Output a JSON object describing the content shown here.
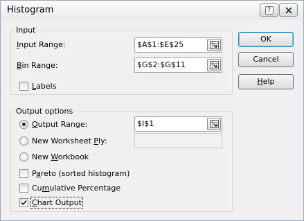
{
  "window": {
    "title": "Histogram"
  },
  "input_group": {
    "label": "Input",
    "input_range": {
      "label_pre": "",
      "label_ul": "I",
      "label_post": "nput Range:",
      "value": "$A$1:$E$25"
    },
    "bin_range": {
      "label_pre": "",
      "label_ul": "B",
      "label_post": "in Range:",
      "value": "$G$2:$G$11"
    },
    "labels": {
      "label_pre": "",
      "label_ul": "L",
      "label_post": "abels",
      "checked": false
    }
  },
  "output_group": {
    "label": "Output options",
    "output_range": {
      "label_pre": "",
      "label_ul": "O",
      "label_post": "utput Range:",
      "value": "$I$1",
      "selected": true
    },
    "new_worksheet": {
      "label_pre": "New Worksheet ",
      "label_ul": "P",
      "label_post": "ly:",
      "value": "",
      "selected": false
    },
    "new_workbook": {
      "label_pre": "New ",
      "label_ul": "W",
      "label_post": "orkbook",
      "selected": false
    },
    "pareto": {
      "label_pre": "P",
      "label_ul": "a",
      "label_post": "reto (sorted histogram)",
      "checked": false
    },
    "cumulative": {
      "label_pre": "Cu",
      "label_ul": "m",
      "label_post": "ulative Percentage",
      "checked": false
    },
    "chart_output": {
      "label_pre": "",
      "label_ul": "C",
      "label_post": "hart Output",
      "checked": true
    }
  },
  "buttons": {
    "ok": "OK",
    "cancel": "Cancel",
    "help_pre": "",
    "help_ul": "H",
    "help_post": "elp"
  },
  "titlebar": {
    "help_glyph": "?"
  },
  "icons": {
    "collapse": "range-collapse-icon",
    "close": "close-icon",
    "help": "question-icon",
    "check": "checkmark-icon"
  }
}
